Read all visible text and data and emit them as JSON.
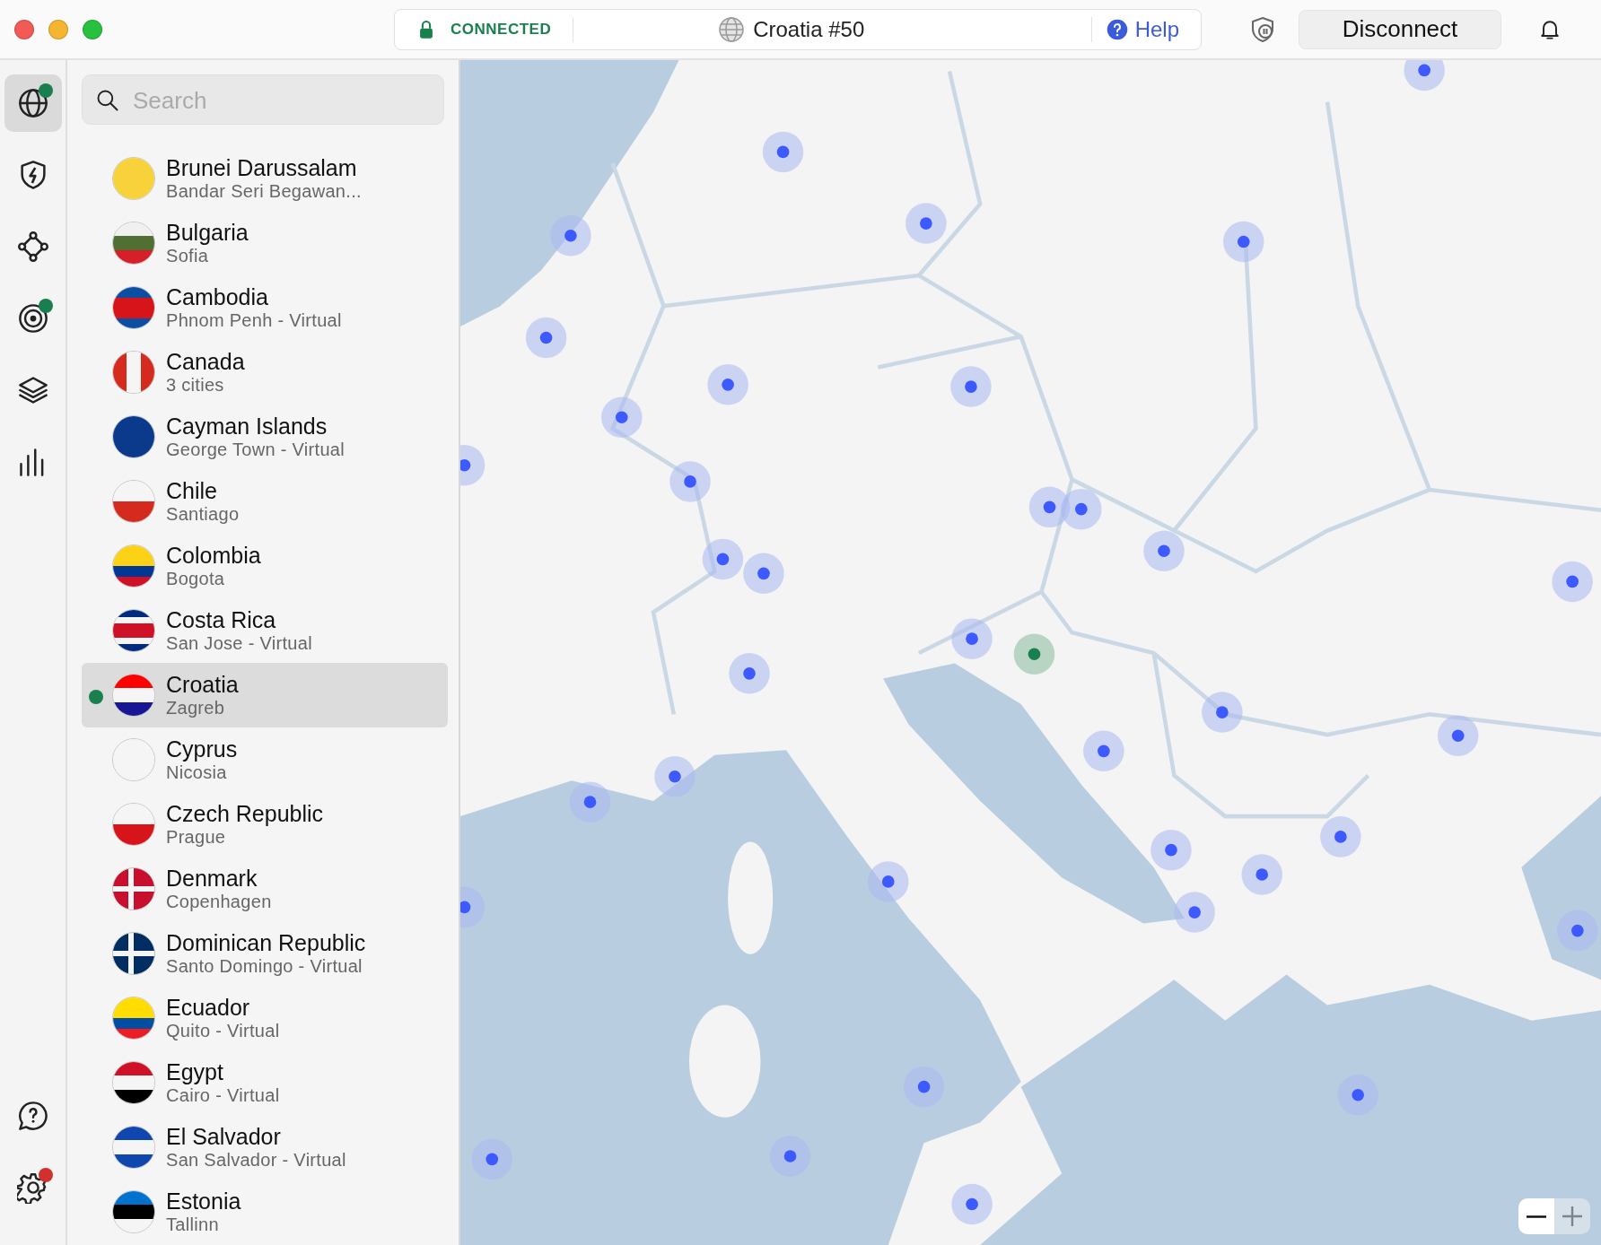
{
  "window": {
    "controls": [
      {
        "kind": "close"
      },
      {
        "kind": "minimize"
      },
      {
        "kind": "zoom"
      }
    ]
  },
  "status": {
    "state": "CONNECTED",
    "server": "Croatia #50",
    "help": "Help"
  },
  "toolbar": {
    "disconnect": "Disconnect"
  },
  "nav": {
    "top": [
      {
        "kind": "globe",
        "selected": true,
        "color": "#1a7f4e"
      },
      {
        "kind": "shield",
        "selected": false
      },
      {
        "kind": "mesh",
        "selected": false
      },
      {
        "kind": "target",
        "selected": false,
        "color": "#1a7f4e"
      },
      {
        "kind": "layers",
        "selected": false
      },
      {
        "kind": "stats",
        "selected": false
      }
    ],
    "bottom": [
      {
        "kind": "help",
        "selected": false
      },
      {
        "kind": "settings",
        "selected": false,
        "color": "#d0312d"
      }
    ]
  },
  "search": {
    "placeholder": "Search"
  },
  "countries": [
    {
      "name": "Brunei Darussalam",
      "city": "Bandar Seri Begawan...",
      "selected": false,
      "connected": false
    },
    {
      "name": "Bulgaria",
      "city": "Sofia",
      "selected": false,
      "connected": false
    },
    {
      "name": "Cambodia",
      "city": "Phnom Penh - Virtual",
      "selected": false,
      "connected": false
    },
    {
      "name": "Canada",
      "city": "3 cities",
      "selected": false,
      "connected": false
    },
    {
      "name": "Cayman Islands",
      "city": "George Town - Virtual",
      "selected": false,
      "connected": false
    },
    {
      "name": "Chile",
      "city": "Santiago",
      "selected": false,
      "connected": false
    },
    {
      "name": "Colombia",
      "city": "Bogota",
      "selected": false,
      "connected": false
    },
    {
      "name": "Costa Rica",
      "city": "San Jose - Virtual",
      "selected": false,
      "connected": false
    },
    {
      "name": "Croatia",
      "city": "Zagreb",
      "selected": true,
      "connected": true
    },
    {
      "name": "Cyprus",
      "city": "Nicosia",
      "selected": false,
      "connected": false
    },
    {
      "name": "Czech Republic",
      "city": "Prague",
      "selected": false,
      "connected": false
    },
    {
      "name": "Denmark",
      "city": "Copenhagen",
      "selected": false,
      "connected": false
    },
    {
      "name": "Dominican Republic",
      "city": "Santo Domingo - Virtual",
      "selected": false,
      "connected": false
    },
    {
      "name": "Ecuador",
      "city": "Quito - Virtual",
      "selected": false,
      "connected": false
    },
    {
      "name": "Egypt",
      "city": "Cairo - Virtual",
      "selected": false,
      "connected": false
    },
    {
      "name": "El Salvador",
      "city": "San Salvador - Virtual",
      "selected": false,
      "connected": false
    },
    {
      "name": "Estonia",
      "city": "Tallinn",
      "selected": false,
      "connected": false
    }
  ],
  "map": {
    "zoom": [
      {
        "kind": "out",
        "disabled": false
      },
      {
        "kind": "in",
        "disabled": true
      }
    ]
  }
}
